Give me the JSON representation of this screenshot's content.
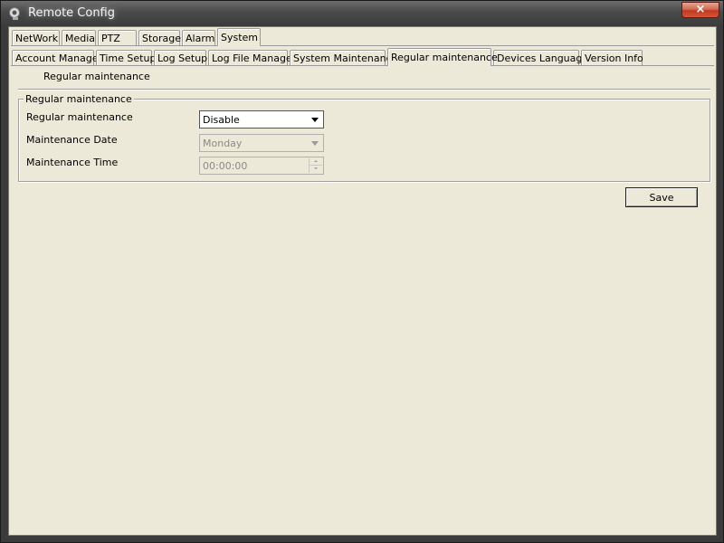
{
  "window": {
    "title": "Remote Config",
    "close_label": "×"
  },
  "top_tabs": [
    "NetWork",
    "Media",
    "PTZ",
    "Storage",
    "Alarm",
    "System"
  ],
  "system_tabs": [
    "Account Manage",
    "Time Setup",
    "Log Setup",
    "Log File Manage",
    "System Maintenance",
    "Regular maintenance",
    "Devices Language",
    "Version Info"
  ],
  "page": {
    "section_label": "Regular maintenance"
  },
  "group": {
    "title": "Regular maintenance",
    "rows": [
      {
        "label": "Regular maintenance",
        "value": "Disable"
      },
      {
        "label": "Maintenance Date",
        "value": "Monday"
      },
      {
        "label": "Maintenance Time",
        "value": "00:00:00"
      }
    ]
  },
  "actions": {
    "save_label": "Save"
  },
  "colors": {
    "surface": "#ece9d8",
    "close_button": "#c0391f",
    "frame": "#3b3b3b"
  }
}
